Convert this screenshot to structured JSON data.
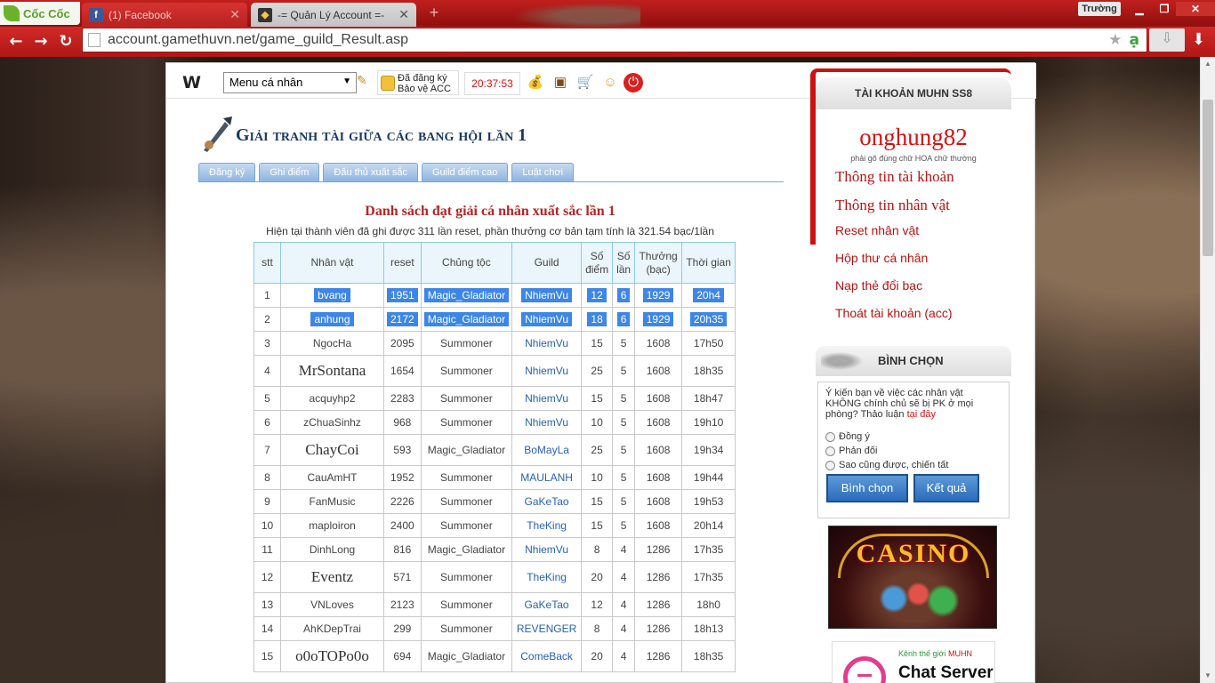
{
  "browser": {
    "brand": "Cốc Cốc",
    "tabs": [
      {
        "title": "(1) Facebook",
        "active": false
      },
      {
        "title": "-= Quản Lý Account =-",
        "active": true
      }
    ],
    "user_label": "Trường",
    "url": "account.gamethuvn.net/game_guild_Result.asp"
  },
  "header": {
    "logo": "W",
    "menu_select": "Menu cá nhân",
    "guard_line1": "Đã đăng ký",
    "guard_line2": "Bảo vệ ACC",
    "clock": "20:37:53"
  },
  "page": {
    "title": "Giải tranh tài giữa các bang hội lần 1",
    "tabs": [
      "Đăng ký",
      "Ghi điểm",
      "Đấu thủ xuất sắc",
      "Guild điểm cao",
      "Luật chơi"
    ],
    "list_title": "Danh sách đạt giải cá nhân xuất sắc lần 1",
    "list_desc": "Hiện tại thành viên đã ghi được 311 lần reset, phần thưởng cơ bản tạm tính là 321.54 bạc/1lần"
  },
  "table": {
    "headers": [
      "stt",
      "Nhân vật",
      "reset",
      "Chủng tộc",
      "Guild",
      "Số điểm",
      "Số lần",
      "Thưởng (bạc)",
      "Thời gian"
    ],
    "rows": [
      [
        "1",
        "bvang",
        "1951",
        "Magic_Gladiator",
        "NhiemVu",
        "12",
        "6",
        "1929",
        "20h4"
      ],
      [
        "2",
        "anhung",
        "2172",
        "Magic_Gladiator",
        "NhiemVu",
        "18",
        "6",
        "1929",
        "20h35"
      ],
      [
        "3",
        "NgocHa",
        "2095",
        "Summoner",
        "NhiemVu",
        "15",
        "5",
        "1608",
        "17h50"
      ],
      [
        "4",
        "MrSontana",
        "1654",
        "Summoner",
        "NhiemVu",
        "25",
        "5",
        "1608",
        "18h35"
      ],
      [
        "5",
        "acquyhp2",
        "2283",
        "Summoner",
        "NhiemVu",
        "15",
        "5",
        "1608",
        "18h47"
      ],
      [
        "6",
        "zChuaSinhz",
        "968",
        "Summoner",
        "NhiemVu",
        "10",
        "5",
        "1608",
        "19h10"
      ],
      [
        "7",
        "ChayCoi",
        "593",
        "Magic_Gladiator",
        "BoMayLa",
        "25",
        "5",
        "1608",
        "19h34"
      ],
      [
        "8",
        "CauAmHT",
        "1952",
        "Summoner",
        "MAULANH",
        "10",
        "5",
        "1608",
        "19h44"
      ],
      [
        "9",
        "FanMusic",
        "2226",
        "Summoner",
        "GaKeTao",
        "15",
        "5",
        "1608",
        "19h53"
      ],
      [
        "10",
        "maploiron",
        "2400",
        "Summoner",
        "TheKing",
        "15",
        "5",
        "1608",
        "20h14"
      ],
      [
        "11",
        "DinhLong",
        "816",
        "Magic_Gladiator",
        "NhiemVu",
        "8",
        "4",
        "1286",
        "17h35"
      ],
      [
        "12",
        "Eventz",
        "571",
        "Summoner",
        "TheKing",
        "20",
        "4",
        "1286",
        "17h35"
      ],
      [
        "13",
        "VNLoves",
        "2123",
        "Summoner",
        "GaKeTao",
        "12",
        "4",
        "1286",
        "18h0"
      ],
      [
        "14",
        "AhKDepTrai",
        "299",
        "Summoner",
        "REVENGER",
        "8",
        "4",
        "1286",
        "18h13"
      ],
      [
        "15",
        "o0oTOPo0o",
        "694",
        "Magic_Gladiator",
        "ComeBack",
        "20",
        "4",
        "1286",
        "18h35"
      ]
    ]
  },
  "sidebar": {
    "account_head": "TÀI KHOẢN MUHN SS8",
    "username": "onghung82",
    "note": "phải gõ đúng chữ HOA chữ thường",
    "links": [
      "Thông tin tài khoản",
      "Thông tin nhân vật",
      "Reset nhân vật",
      "Hộp thư cá nhân",
      "Nạp thẻ đổi bạc",
      "Thoát tài khoản (acc)"
    ],
    "vote_head": "BÌNH CHỌN",
    "vote_question": "Ý kiến bạn về việc các nhân vật KHÔNG chính chủ sẽ bị PK ở mọi phòng? Thảo luận",
    "vote_link": "tại đây",
    "vote_options": [
      "Đồng ý",
      "Phản đối",
      "Sao cũng được, chiến tất"
    ],
    "vote_button": "Bình chọn",
    "result_button": "Kết quả",
    "casino_word": "CASINO",
    "chat_caption_a": "Kênh thế giới",
    "chat_caption_b": "MUHN",
    "chat_big": "Chat Server"
  }
}
